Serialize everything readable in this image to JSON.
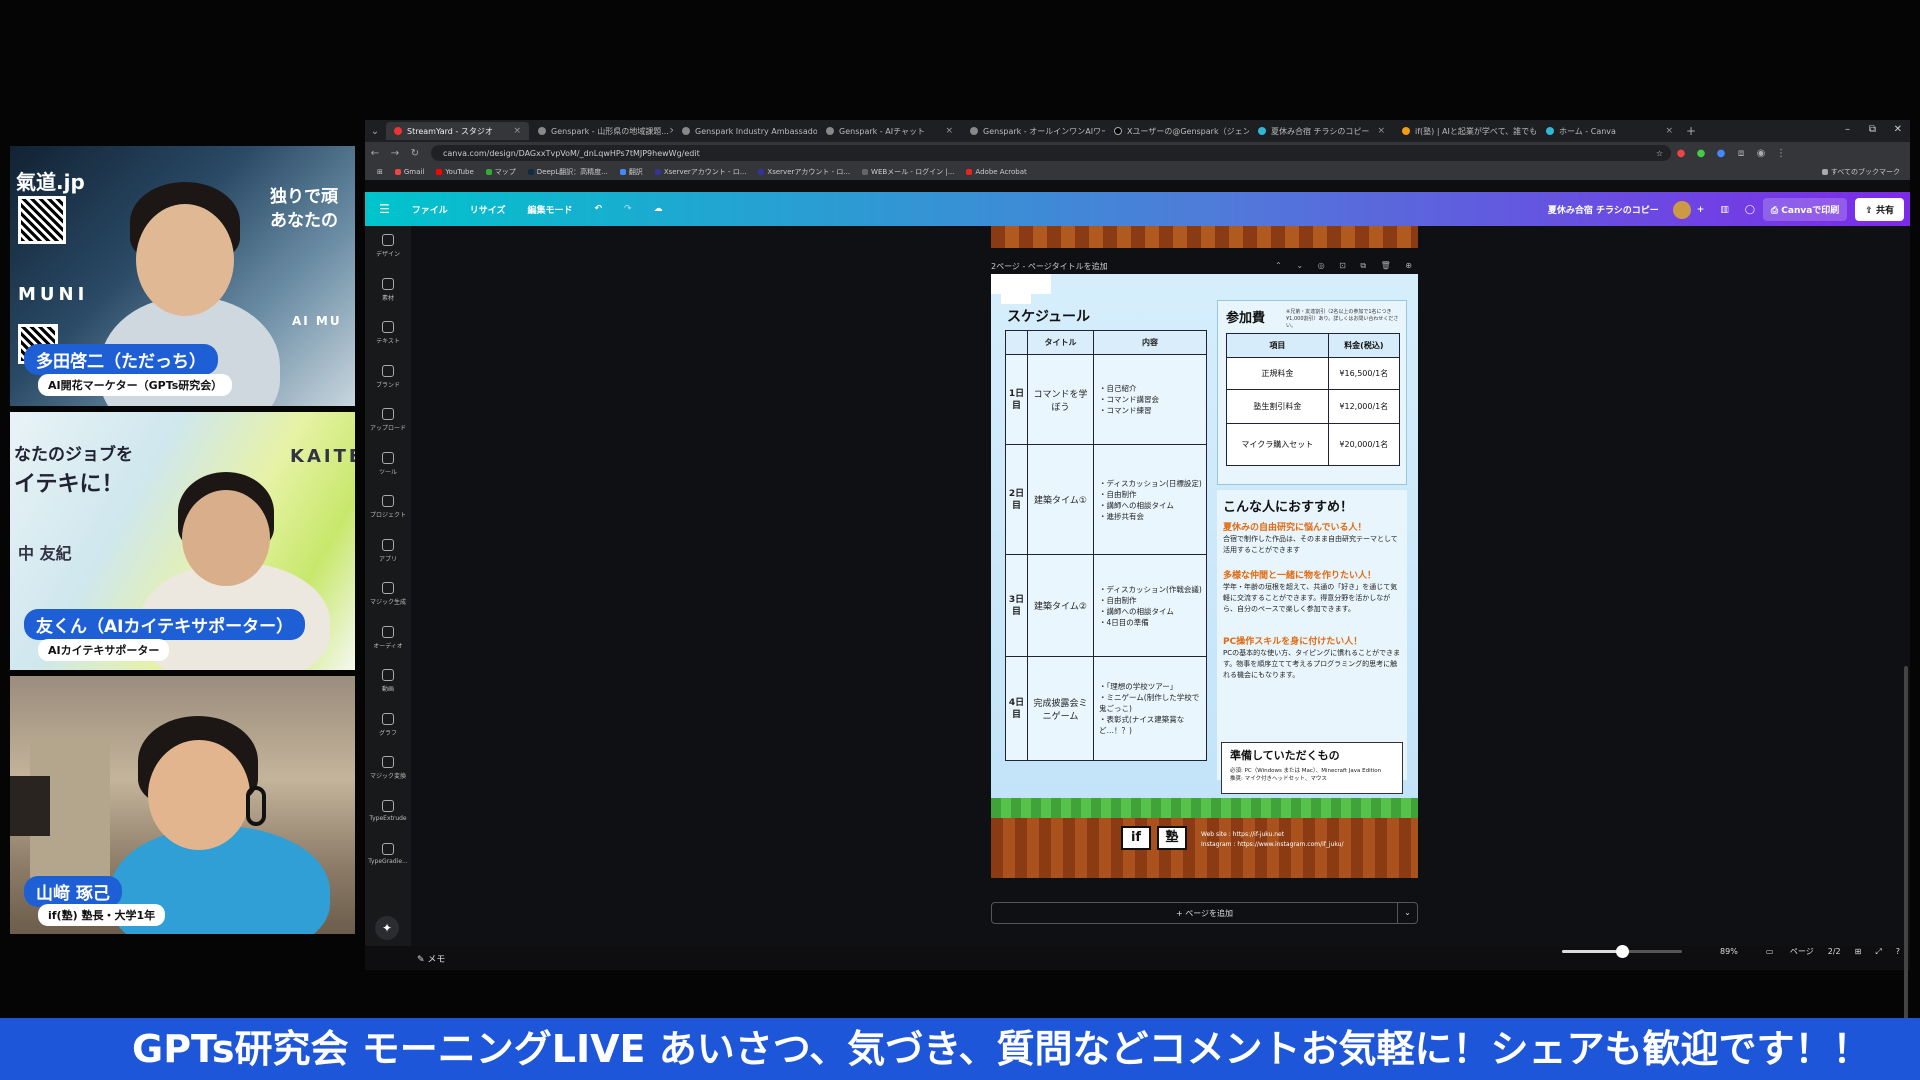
{
  "cams": [
    {
      "name": "多田啓二（ただっち）",
      "role": "AI開花マーケター（GPTs研究会）",
      "overlay_site": "氣道.jp",
      "overlay_brand": "MUNI",
      "overlay_catch1": "独りで頑",
      "overlay_catch2": "あなたの",
      "overlay_brand2": "AI MU"
    },
    {
      "name": "友くん（AIカイテキサポーター）",
      "role": "AIカイテキサポーター",
      "overlay_line1": "なたのジョブを",
      "overlay_line2": "イテキに！",
      "overlay_brand": "KAITE",
      "overlay_name": "中 友紀"
    },
    {
      "name": "山﨑 琢己",
      "role": "if(塾) 塾長・大学1年"
    }
  ],
  "browser": {
    "tabs": [
      {
        "label": "StreamYard - スタジオ",
        "active": true
      },
      {
        "label": "Genspark - 山形県の地域課題...",
        "active": false
      },
      {
        "label": "Genspark Industry Ambassado...",
        "active": false
      },
      {
        "label": "Genspark - AIチャット",
        "active": false
      },
      {
        "label": "Genspark - オールインワンAIワーク...",
        "active": false
      },
      {
        "label": "Xユーザーの@Genspark（ジェンスパ...",
        "active": false
      },
      {
        "label": "夏休み合宿 チラシのコピー",
        "active": false
      },
      {
        "label": "if(塾) | AIと起業が学べて、誰でも...",
        "active": false
      },
      {
        "label": "ホーム - Canva",
        "active": false
      }
    ],
    "new_tab": "+",
    "url": "canva.com/design/DAGxxTvpVoM/_dnLqwHPs7tMJP9hewWg/edit",
    "bookmarks": [
      "Gmail",
      "YouTube",
      "マップ",
      "DeepL翻訳：高精度...",
      "翻訳",
      "Xserverアカウント - ロ...",
      "Xserverアカウント - ロ...",
      "WEBメール - ログイン |...",
      "Adobe Acrobat"
    ],
    "bookmarks_all": "すべてのブックマーク"
  },
  "canva": {
    "menu": [
      "ファイル",
      "リサイズ",
      "編集モード"
    ],
    "doc_title": "夏休み合宿 チラシのコピー",
    "print_label": "Canvaで印刷",
    "share_label": "共有",
    "sidebar": [
      "デザイン",
      "素材",
      "テキスト",
      "ブランド",
      "アップロード",
      "ツール",
      "プロジェクト",
      "アプリ",
      "マジック生成",
      "オーディオ",
      "動画",
      "グラフ",
      "マジック変換",
      "TypeExtrude",
      "TypeGradie..."
    ],
    "page_header": "2ページ - ページタイトルを追加",
    "page_tools": "⌃ ⌄ ◎ ⊡ ⧉ 🗑 ⊕",
    "add_page": "+ ページを追加",
    "memo": "メモ",
    "zoom_fraction": 0.5,
    "zoom": "89%",
    "pages_label": "ページ",
    "page_count": "2/2"
  },
  "flyer": {
    "schedule_title": "スケジュール",
    "headers": [
      "タイトル",
      "内容"
    ],
    "rows": [
      {
        "day": "1日目",
        "title": "コマンドを学ぼう",
        "content": "・自己紹介\n・コマンド講習会\n・コマンド練習"
      },
      {
        "day": "2日目",
        "title": "建築タイム①",
        "content": "・ディスカッション(日標設定)\n・自由制作\n・講師への相談タイム\n・進捗共有会"
      },
      {
        "day": "3日目",
        "title": "建築タイム②",
        "content": "・ディスカッション(作戦会議)\n・自由制作\n・講師への相談タイム\n・4日目の準備"
      },
      {
        "day": "4日目",
        "title": "完成披露会ミニゲーム",
        "content": "・「理想の学校ツアー」\n・ミニゲーム(制作した学校で鬼ごっこ)\n・表彰式(ナイス建築賞など…！？)"
      }
    ],
    "fee_title": "参加費",
    "fee_note": "※兄弟・友達割引（2名以上の参加で1名につき¥1,000割引）あり。詳しくはお問い合わせください。",
    "fee_headers": [
      "項目",
      "料金(税込)"
    ],
    "fees": [
      {
        "item": "正規料金",
        "price": "¥16,500/1名"
      },
      {
        "item": "塾生割引料金",
        "price": "¥12,000/1名"
      },
      {
        "item": "マイクラ購入セット",
        "price": "¥20,000/1名"
      }
    ],
    "rec_title": "こんな人におすすめ！",
    "rec": [
      {
        "head": "夏休みの自由研究に悩んでいる人！",
        "text": "合宿で制作した作品は、そのまま自由研究テーマとして活用することができます"
      },
      {
        "head": "多様な仲間と一緒に物を作りたい人！",
        "text": "学年・年齢の垣根を超えて、共通の「好き」を通じて気軽に交流することができます。得意分野を活かしながら、自分のペースで楽しく参加できます。"
      },
      {
        "head": "PC操作スキルを身に付けたい人！",
        "text": "PCの基本的な使い方、タイピングに慣れることができます。物事を順序立てて考えるプログラミング的思考に触れる機会にもなります。"
      }
    ],
    "prep_title": "準備していただくもの",
    "prep_text1": "必須: PC（Windows または Mac）、Minecraft Java Edition",
    "prep_text2": "推奨: マイク付きヘッドセット、マウス",
    "logo1": "if",
    "logo2": "塾",
    "footer1": "Web site : https://if-juku.net",
    "footer2": "Instagram : https://www.instagram.com/if_juku/"
  },
  "banner": "GPTs研究会 モーニングLIVE あいさつ、気づき、質問などコメントお気軽に！シェアも歓迎です！！"
}
